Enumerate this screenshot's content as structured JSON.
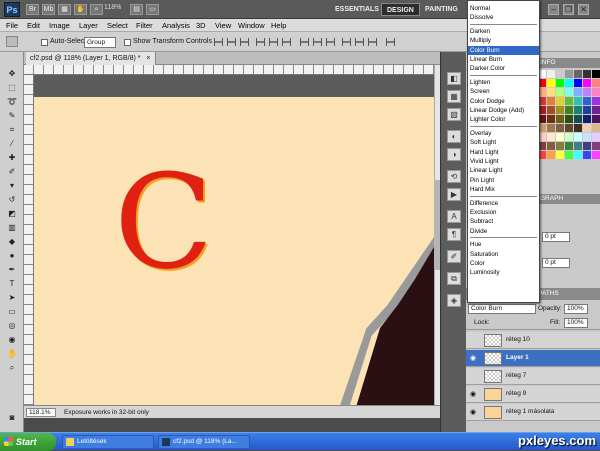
{
  "app": {
    "logo": "Ps",
    "zoom": "118%"
  },
  "workspace": {
    "essentials": "ESSENTIALS",
    "design": "DESIGN",
    "painting": "PAINTING"
  },
  "window_controls": {
    "minimize": "–",
    "restore": "❐",
    "close": "✕"
  },
  "menu": [
    "File",
    "Edit",
    "Image",
    "Layer",
    "Select",
    "Filter",
    "Analysis",
    "3D",
    "View",
    "Window",
    "Help"
  ],
  "options": {
    "auto_select": "Auto-Select:",
    "auto_select_value": "Group",
    "show_transform": "Show Transform Controls"
  },
  "document": {
    "tab": "cf2.psd @ 118% (Layer 1, RGB/8) *",
    "close": "×",
    "letter": "C"
  },
  "status": {
    "zoom": "118.1%",
    "message": "Exposure works in 32-bit only"
  },
  "panels": {
    "swatches_tab": "INFO",
    "paragraph_tab": "GRAPH",
    "indent_first": "0 pt",
    "space_after": "0 pt",
    "layers_tab": "PATHS",
    "blend_mode": "Color Burn",
    "opacity_label": "Opacity:",
    "opacity": "100%",
    "lock_label": "Lock:",
    "fill_label": "Fill:",
    "fill": "100%"
  },
  "layers": [
    {
      "name": "réteg 10",
      "visible": false,
      "active": false,
      "thumb": "transparent"
    },
    {
      "name": "Layer 1",
      "visible": true,
      "active": true,
      "thumb": "transparent"
    },
    {
      "name": "réteg 7",
      "visible": false,
      "active": false,
      "thumb": "transparent"
    },
    {
      "name": "réteg 9",
      "visible": true,
      "active": false,
      "thumb": "fill"
    },
    {
      "name": "réteg 1 másolata",
      "visible": true,
      "active": false,
      "thumb": "fill"
    }
  ],
  "blend_menu": {
    "selected": "Color Burn",
    "groups": [
      [
        "Normal",
        "Dissolve"
      ],
      [
        "Darken",
        "Multiply",
        "Color Burn",
        "Linear Burn",
        "Darker Color"
      ],
      [
        "Lighten",
        "Screen",
        "Color Dodge",
        "Linear Dodge (Add)",
        "Lighter Color"
      ],
      [
        "Overlay",
        "Soft Light",
        "Hard Light",
        "Vivid Light",
        "Linear Light",
        "Pin Light",
        "Hard Mix"
      ],
      [
        "Difference",
        "Exclusion",
        "Subtract",
        "Divide"
      ],
      [
        "Hue",
        "Saturation",
        "Color",
        "Luminosity"
      ]
    ]
  },
  "taskbar": {
    "start": "Start",
    "items": [
      "Letöltések",
      "cf2.psd @ 118% (La..."
    ]
  },
  "watermark": "pxleyes.com",
  "colors": {
    "canvas": "#fbe3b6",
    "letter": "#e02010",
    "foreground": "#1e0c08",
    "selection": "#3d6fc2"
  }
}
